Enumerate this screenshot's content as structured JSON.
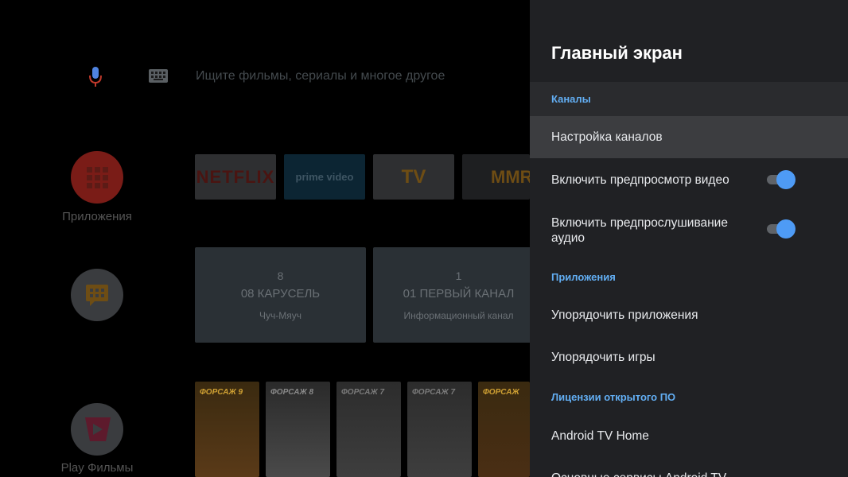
{
  "search": {
    "placeholder": "Ищите фильмы, сериалы и многое другое"
  },
  "sidebar": {
    "apps_label": "Приложения",
    "movies_label": "Play Фильмы"
  },
  "favorites": [
    "NETFLIX",
    "prime video",
    "TV",
    "MMR"
  ],
  "channels": [
    {
      "number": "8",
      "name": "08 КАРУСЕЛЬ",
      "program": "Чуч-Мяуч"
    },
    {
      "number": "1",
      "name": "01 ПЕРВЫЙ КАНАЛ",
      "program": "Информационный канал"
    }
  ],
  "posters": [
    "ФОРСАЖ 9",
    "ФОРСАЖ 8",
    "ФОРСАЖ 7",
    "ФОРСАЖ 7",
    "ФОРСАЖ"
  ],
  "panel": {
    "title": "Главный экран",
    "section_channels": "Каналы",
    "setup_channels": "Настройка каналов",
    "video_preview": "Включить предпросмотр видео",
    "audio_preview": "Включить предпрослушивание аудио",
    "section_apps": "Приложения",
    "sort_apps": "Упорядочить приложения",
    "sort_games": "Упорядочить игры",
    "section_licenses": "Лицензии открытого ПО",
    "android_tv_home": "Android TV Home",
    "core_services": "Основные сервисы Android TV"
  },
  "toggles": {
    "video_preview_on": true,
    "audio_preview_on": true
  },
  "colors": {
    "accent": "#4e9bf5",
    "section": "#62aef3",
    "panel_bg": "#202124",
    "highlight": "#3c3d40"
  }
}
